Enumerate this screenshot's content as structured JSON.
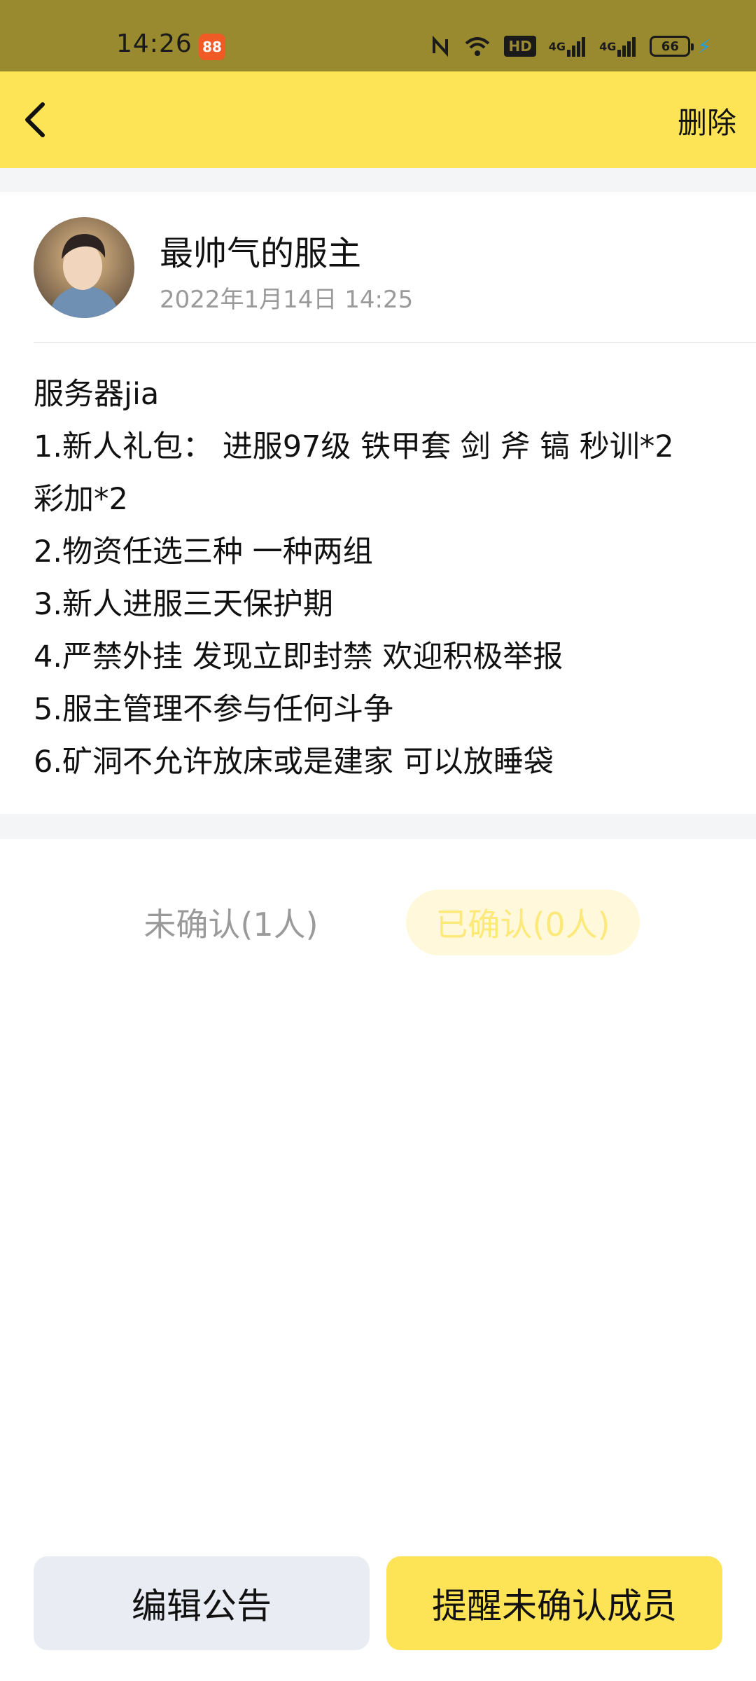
{
  "status_bar": {
    "time": "14:26",
    "app_icon_label": "88",
    "network_label_1": "4G",
    "network_label_2": "4G",
    "hd_label": "HD",
    "battery_level": "66"
  },
  "nav": {
    "delete_label": "删除"
  },
  "post": {
    "author_name": "最帅气的服主",
    "timestamp": "2022年1月14日 14:25",
    "lines": [
      "服务器jia",
      "1.新人礼包：  进服97级 铁甲套 剑 斧 镐 秒训*2",
      "彩加*2",
      "2.物资任选三种 一种两组",
      "3.新人进服三天保护期",
      "4.严禁外挂 发现立即封禁 欢迎积极举报",
      "5.服主管理不参与任何斗争",
      "6.矿洞不允许放床或是建家 可以放睡袋"
    ]
  },
  "tabs": {
    "unconfirmed_label": "未确认(1人)",
    "confirmed_label": "已确认(0人)"
  },
  "actions": {
    "edit_label": "编辑公告",
    "remind_label": "提醒未确认成员"
  },
  "colors": {
    "accent": "#fde356",
    "status_bar": "#998a30",
    "confirmed_tab_bg": "#fff8da",
    "edit_button_bg": "#e9ecf3"
  }
}
